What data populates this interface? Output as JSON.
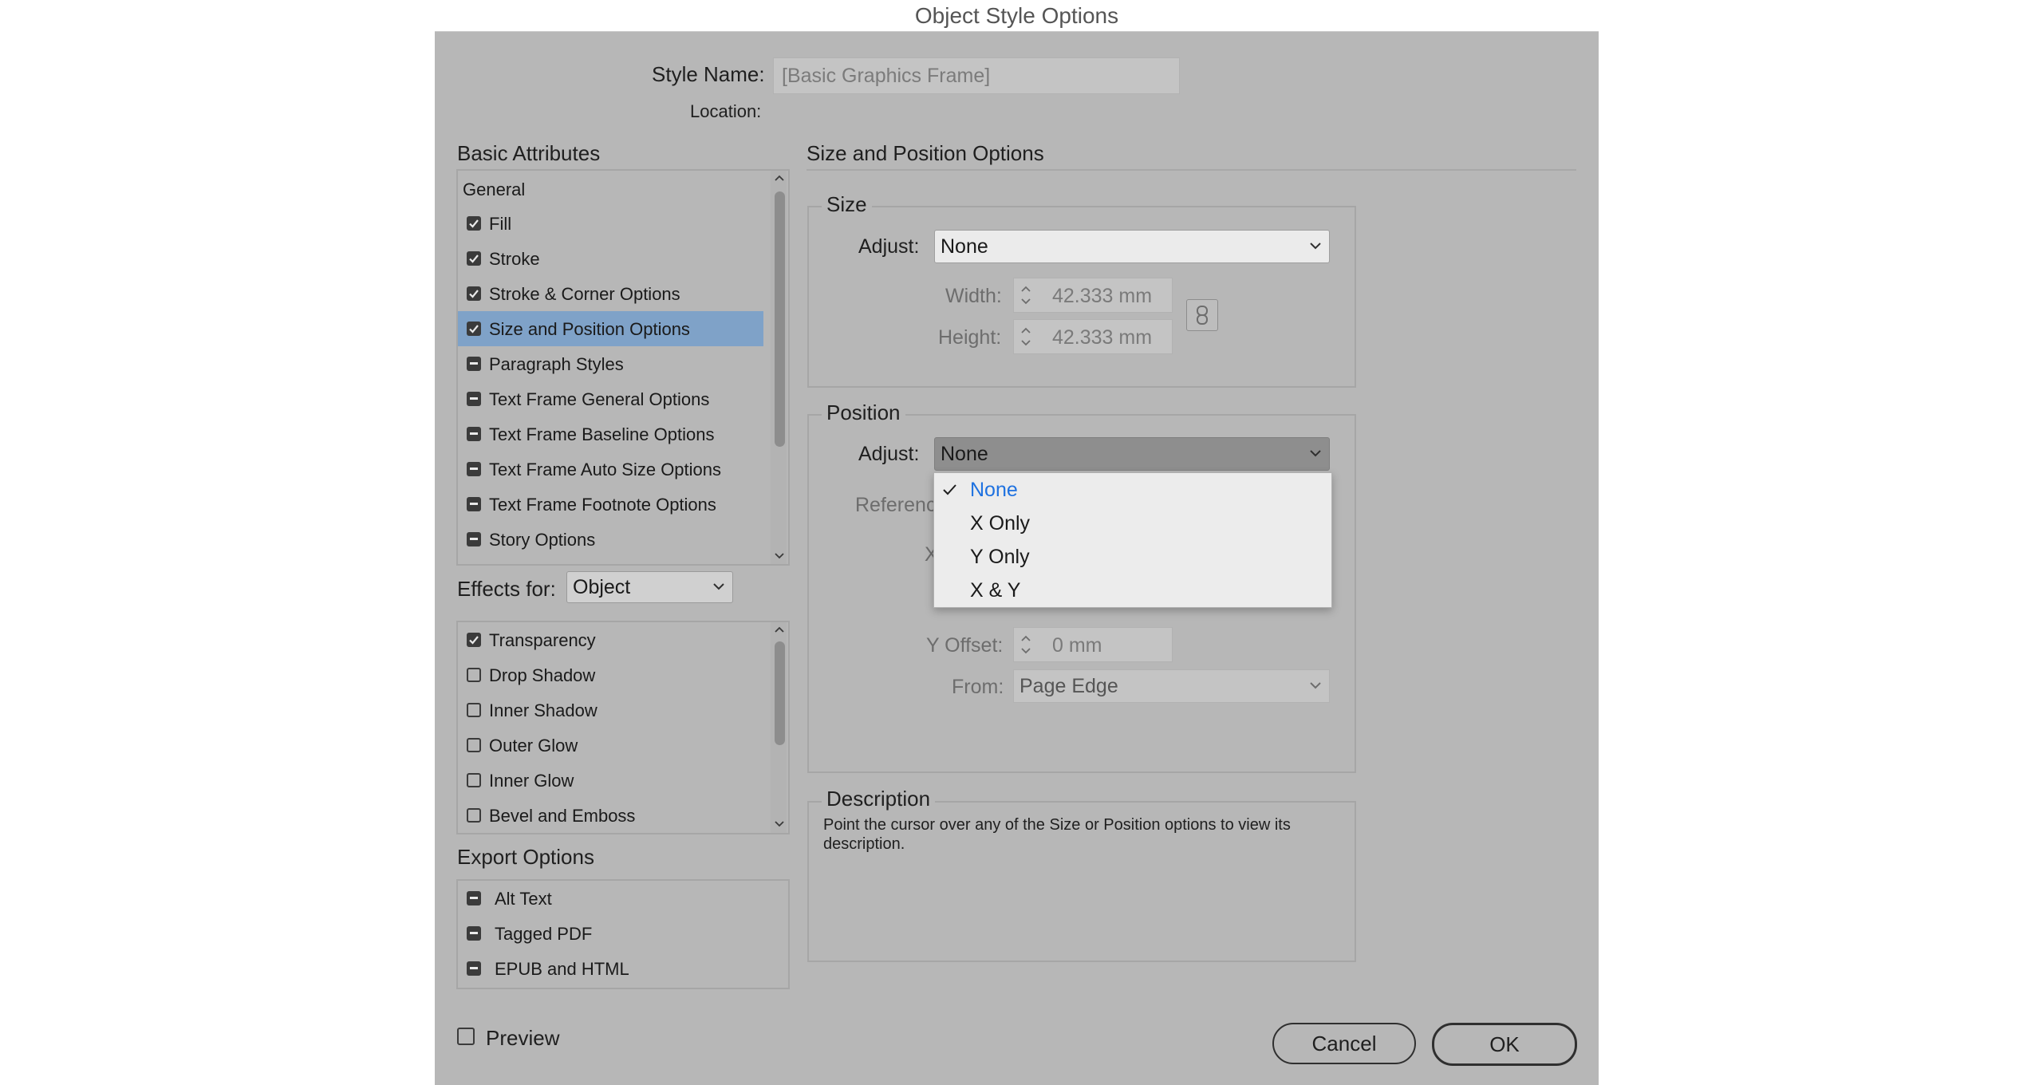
{
  "window": {
    "title": "Object Style Options"
  },
  "style": {
    "name_label": "Style Name:",
    "name_value": "[Basic Graphics Frame]",
    "location_label": "Location:"
  },
  "basic_attributes": {
    "heading": "Basic Attributes",
    "general": "General",
    "items": [
      {
        "label": "Fill",
        "state": "checked"
      },
      {
        "label": "Stroke",
        "state": "checked"
      },
      {
        "label": "Stroke & Corner Options",
        "state": "checked"
      },
      {
        "label": "Size and Position Options",
        "state": "checked",
        "selected": true
      },
      {
        "label": "Paragraph Styles",
        "state": "mixed"
      },
      {
        "label": "Text Frame General Options",
        "state": "mixed"
      },
      {
        "label": "Text Frame Baseline Options",
        "state": "mixed"
      },
      {
        "label": "Text Frame Auto Size Options",
        "state": "mixed"
      },
      {
        "label": "Text Frame Footnote Options",
        "state": "mixed"
      },
      {
        "label": "Story Options",
        "state": "mixed"
      }
    ]
  },
  "effects": {
    "label": "Effects for:",
    "selected": "Object",
    "items": [
      {
        "label": "Transparency",
        "state": "checked"
      },
      {
        "label": "Drop Shadow",
        "state": "unchecked"
      },
      {
        "label": "Inner Shadow",
        "state": "unchecked"
      },
      {
        "label": "Outer Glow",
        "state": "unchecked"
      },
      {
        "label": "Inner Glow",
        "state": "unchecked"
      },
      {
        "label": "Bevel and Emboss",
        "state": "unchecked"
      }
    ]
  },
  "export_options": {
    "heading": "Export Options",
    "items": [
      {
        "label": "Alt Text",
        "state": "mixed"
      },
      {
        "label": "Tagged PDF",
        "state": "mixed"
      },
      {
        "label": "EPUB and HTML",
        "state": "mixed"
      }
    ]
  },
  "panel": {
    "heading": "Size and Position Options",
    "size": {
      "legend": "Size",
      "adjust_label": "Adjust:",
      "adjust_value": "None",
      "width_label": "Width:",
      "width_value": "42.333 mm",
      "height_label": "Height:",
      "height_value": "42.333 mm"
    },
    "position": {
      "legend": "Position",
      "adjust_label": "Adjust:",
      "adjust_value": "None",
      "reference_label_partial": "Referenc",
      "x_label_partial": "X",
      "y_offset_label": "Y Offset:",
      "y_offset_value": "0 mm",
      "from_label": "From:",
      "from_value": "Page Edge"
    },
    "dropdown": {
      "options": [
        "None",
        "X Only",
        "Y Only",
        "X & Y"
      ],
      "selected": "None"
    },
    "description": {
      "legend": "Description",
      "line1": "Point the cursor over any of the Size or Position options to view its",
      "line2": "description."
    }
  },
  "footer": {
    "preview_label": "Preview",
    "cancel": "Cancel",
    "ok": "OK"
  },
  "colors": {
    "dialog_bg": "#b7b7b7",
    "selection": "#7fa2c8",
    "menu_highlight_text": "#1f72e0"
  }
}
